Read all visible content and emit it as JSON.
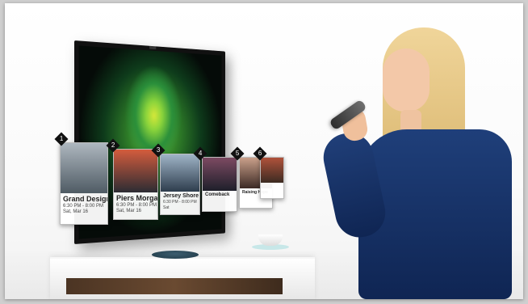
{
  "scene": {
    "cards": [
      {
        "badge": "1",
        "title": "Grand Designs",
        "time": "6:30 PM - 8:00 PM",
        "date": "Sat, Mar 16"
      },
      {
        "badge": "2",
        "title": "Piers Morgan's",
        "time": "6:30 PM - 8:00 PM",
        "date": "Sat, Mar 16"
      },
      {
        "badge": "3",
        "title": "Jersey Shore",
        "time": "6:30 PM - 8:00 PM",
        "date": "Sat"
      },
      {
        "badge": "4",
        "title": "Comeback",
        "time": "",
        "date": ""
      },
      {
        "badge": "5",
        "title": "Raising Hope",
        "time": "",
        "date": ""
      },
      {
        "badge": "6",
        "title": "",
        "time": "",
        "date": ""
      }
    ]
  }
}
